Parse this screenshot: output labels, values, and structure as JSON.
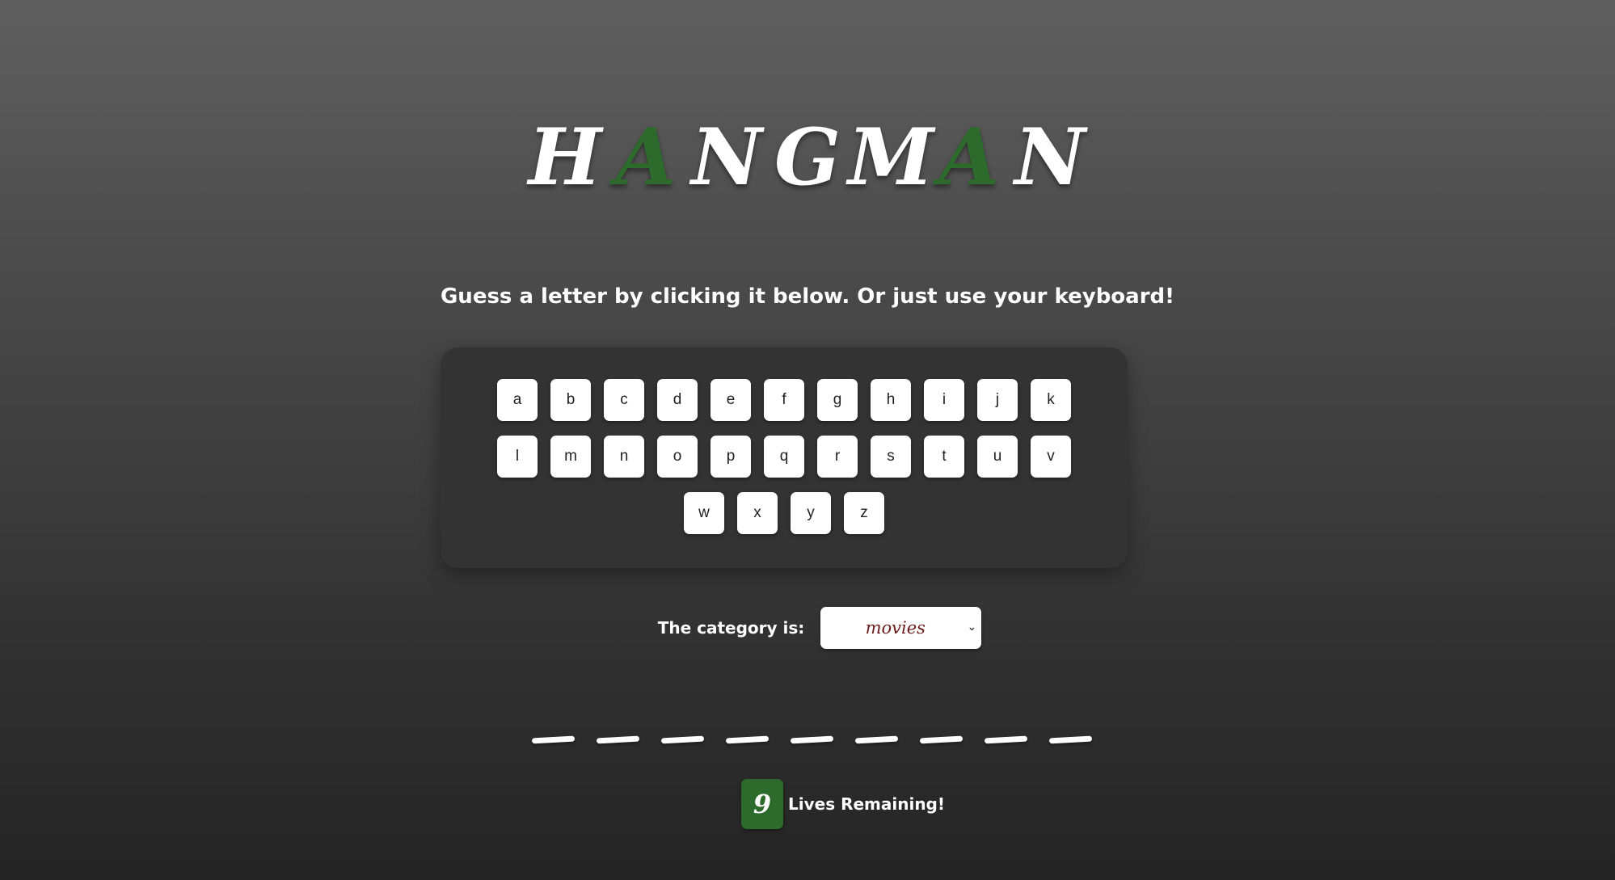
{
  "title": {
    "letters": [
      "H",
      "A",
      "N",
      "G",
      "M",
      "A",
      "N"
    ],
    "accent_color": "#2c6b2c"
  },
  "instructions": "Guess a letter by clicking it below. Or just use your keyboard!",
  "keyboard": {
    "rows": [
      [
        "a",
        "b",
        "c",
        "d",
        "e",
        "f",
        "g",
        "h",
        "i",
        "j",
        "k"
      ],
      [
        "l",
        "m",
        "n",
        "o",
        "p",
        "q",
        "r",
        "s",
        "t",
        "u",
        "v"
      ],
      [
        "w",
        "x",
        "y",
        "z"
      ]
    ]
  },
  "category": {
    "label": "The category is:",
    "value": "movies"
  },
  "word": {
    "blank_count": 9
  },
  "lives": {
    "count": "9",
    "label": "Lives Remaining!"
  }
}
